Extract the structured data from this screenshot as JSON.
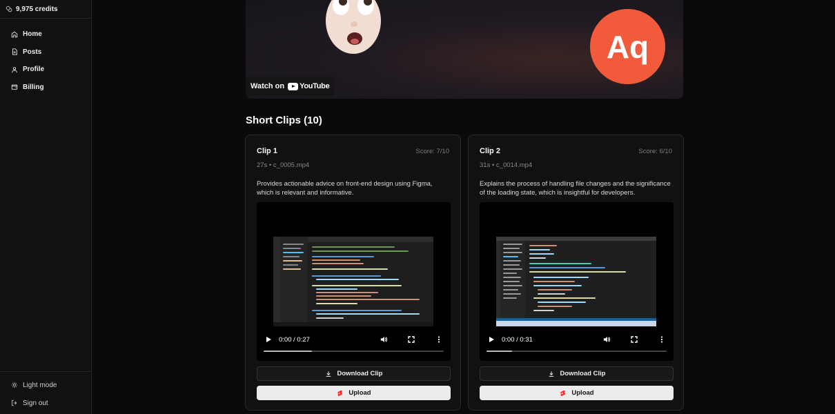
{
  "sidebar": {
    "credits": "9,975 credits",
    "nav": [
      {
        "label": "Home",
        "icon": "home-icon"
      },
      {
        "label": "Posts",
        "icon": "document-icon"
      },
      {
        "label": "Profile",
        "icon": "user-icon"
      },
      {
        "label": "Billing",
        "icon": "wallet-icon"
      }
    ],
    "bottom": [
      {
        "label": "Light mode",
        "icon": "sun-icon"
      },
      {
        "label": "Sign out",
        "icon": "sign-out-icon"
      }
    ]
  },
  "video": {
    "logo_text": "Aq",
    "watch_on": "Watch on",
    "platform": "YouTube"
  },
  "section": {
    "title": "Short Clips (10)"
  },
  "clips": [
    {
      "title": "Clip 1",
      "score": "Score: 7/10",
      "meta": "27s • c_0005.mp4",
      "description": "Provides actionable advice on front-end design using Figma, which is relevant and informative.",
      "time": "0:00 / 0:27",
      "progress": 0.27,
      "download_label": "Download Clip",
      "upload_label": "Upload"
    },
    {
      "title": "Clip 2",
      "score": "Score: 6/10",
      "meta": "31s • c_0014.mp4",
      "description": "Explains the process of handling file changes and the significance of the loading state, which is insightful for developers.",
      "time": "0:00 / 0:31",
      "progress": 0.14,
      "download_label": "Download Clip",
      "upload_label": "Upload"
    }
  ],
  "colors": {
    "logo_bg": "#f25a3c",
    "upload_icon": "#ff2a2a"
  }
}
